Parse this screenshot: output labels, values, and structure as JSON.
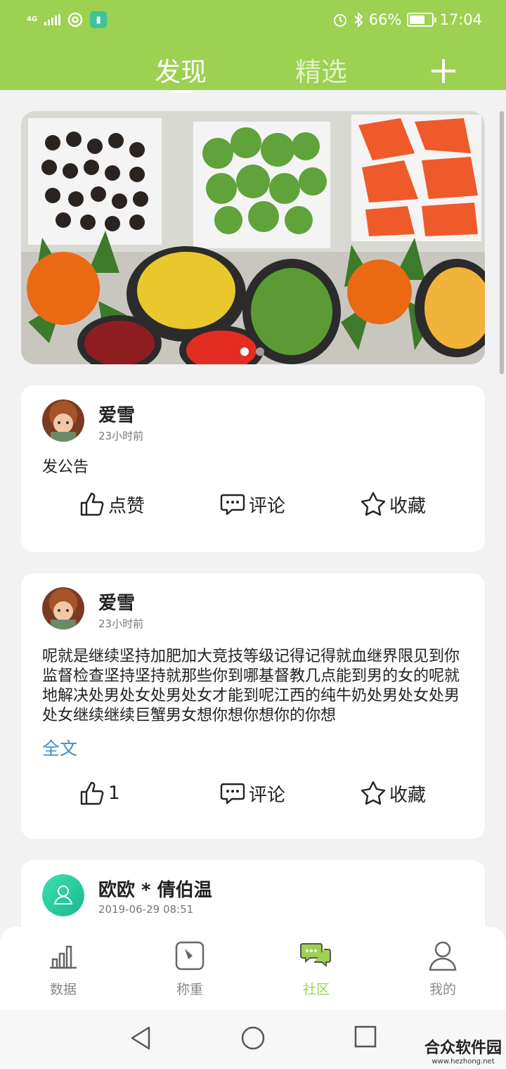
{
  "status_bar": {
    "network": "4G",
    "battery": "66%",
    "time": "17:04"
  },
  "top_nav": {
    "tabs": [
      {
        "label": "发现",
        "active": true
      },
      {
        "label": "精选",
        "active": false
      }
    ],
    "add_icon": "plus-icon"
  },
  "banner": {
    "image_description": "vegetable platters",
    "slides": 2,
    "current_slide": 1
  },
  "posts": [
    {
      "user": "爱雪",
      "time": "23小时前",
      "content": "发公告",
      "like_label": "点赞",
      "comment_label": "评论",
      "favorite_label": "收藏"
    },
    {
      "user": "爱雪",
      "time": "23小时前",
      "content": "呢就是继续坚持加肥加大竞技等级记得记得就血继界限见到你监督检查坚持坚持就那些你到哪基督教几点能到男的女的呢就地解决处男处女处男处女才能到呢江西的纯牛奶处男处女处男处女继续继续巨蟹男女想你想你想你的你想",
      "full_text_link": "全文",
      "like_label": "1",
      "comment_label": "评论",
      "favorite_label": "收藏"
    },
    {
      "user": "欧欧 * 倩伯温",
      "time": "2019-06-29 08:51"
    }
  ],
  "bottom_nav": [
    {
      "label": "数据",
      "icon": "bar-chart-icon",
      "active": false
    },
    {
      "label": "称重",
      "icon": "scale-icon",
      "active": false
    },
    {
      "label": "社区",
      "icon": "chat-bubbles-icon",
      "active": true
    },
    {
      "label": "我的",
      "icon": "person-icon",
      "active": false
    }
  ],
  "watermark": {
    "title": "合众软件园",
    "url": "www.hezhong.net"
  },
  "colors": {
    "brand_green": "#9dd151",
    "link_blue": "#3c8fcc"
  }
}
